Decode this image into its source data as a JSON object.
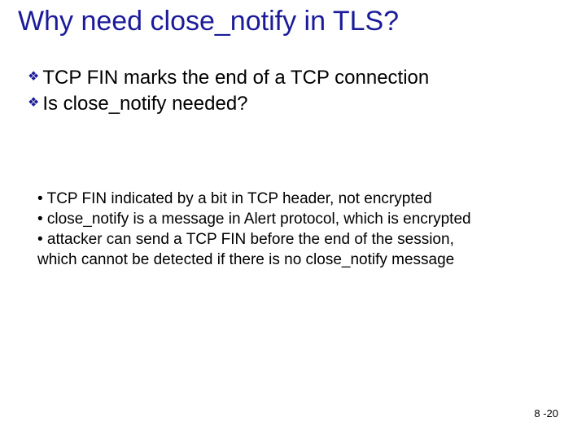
{
  "title": "Why need close_notify in TLS?",
  "bullets": [
    "TCP FIN marks the end of a TCP connection",
    "Is close_notify needed?"
  ],
  "subbullets_lines": [
    "• TCP FIN indicated by a bit in TCP header, not encrypted",
    "• close_notify is a message in Alert protocol, which is encrypted",
    "• attacker can send a TCP FIN before the end of the session,",
    "which cannot be detected if there is no close_notify message"
  ],
  "page": "8 -20"
}
